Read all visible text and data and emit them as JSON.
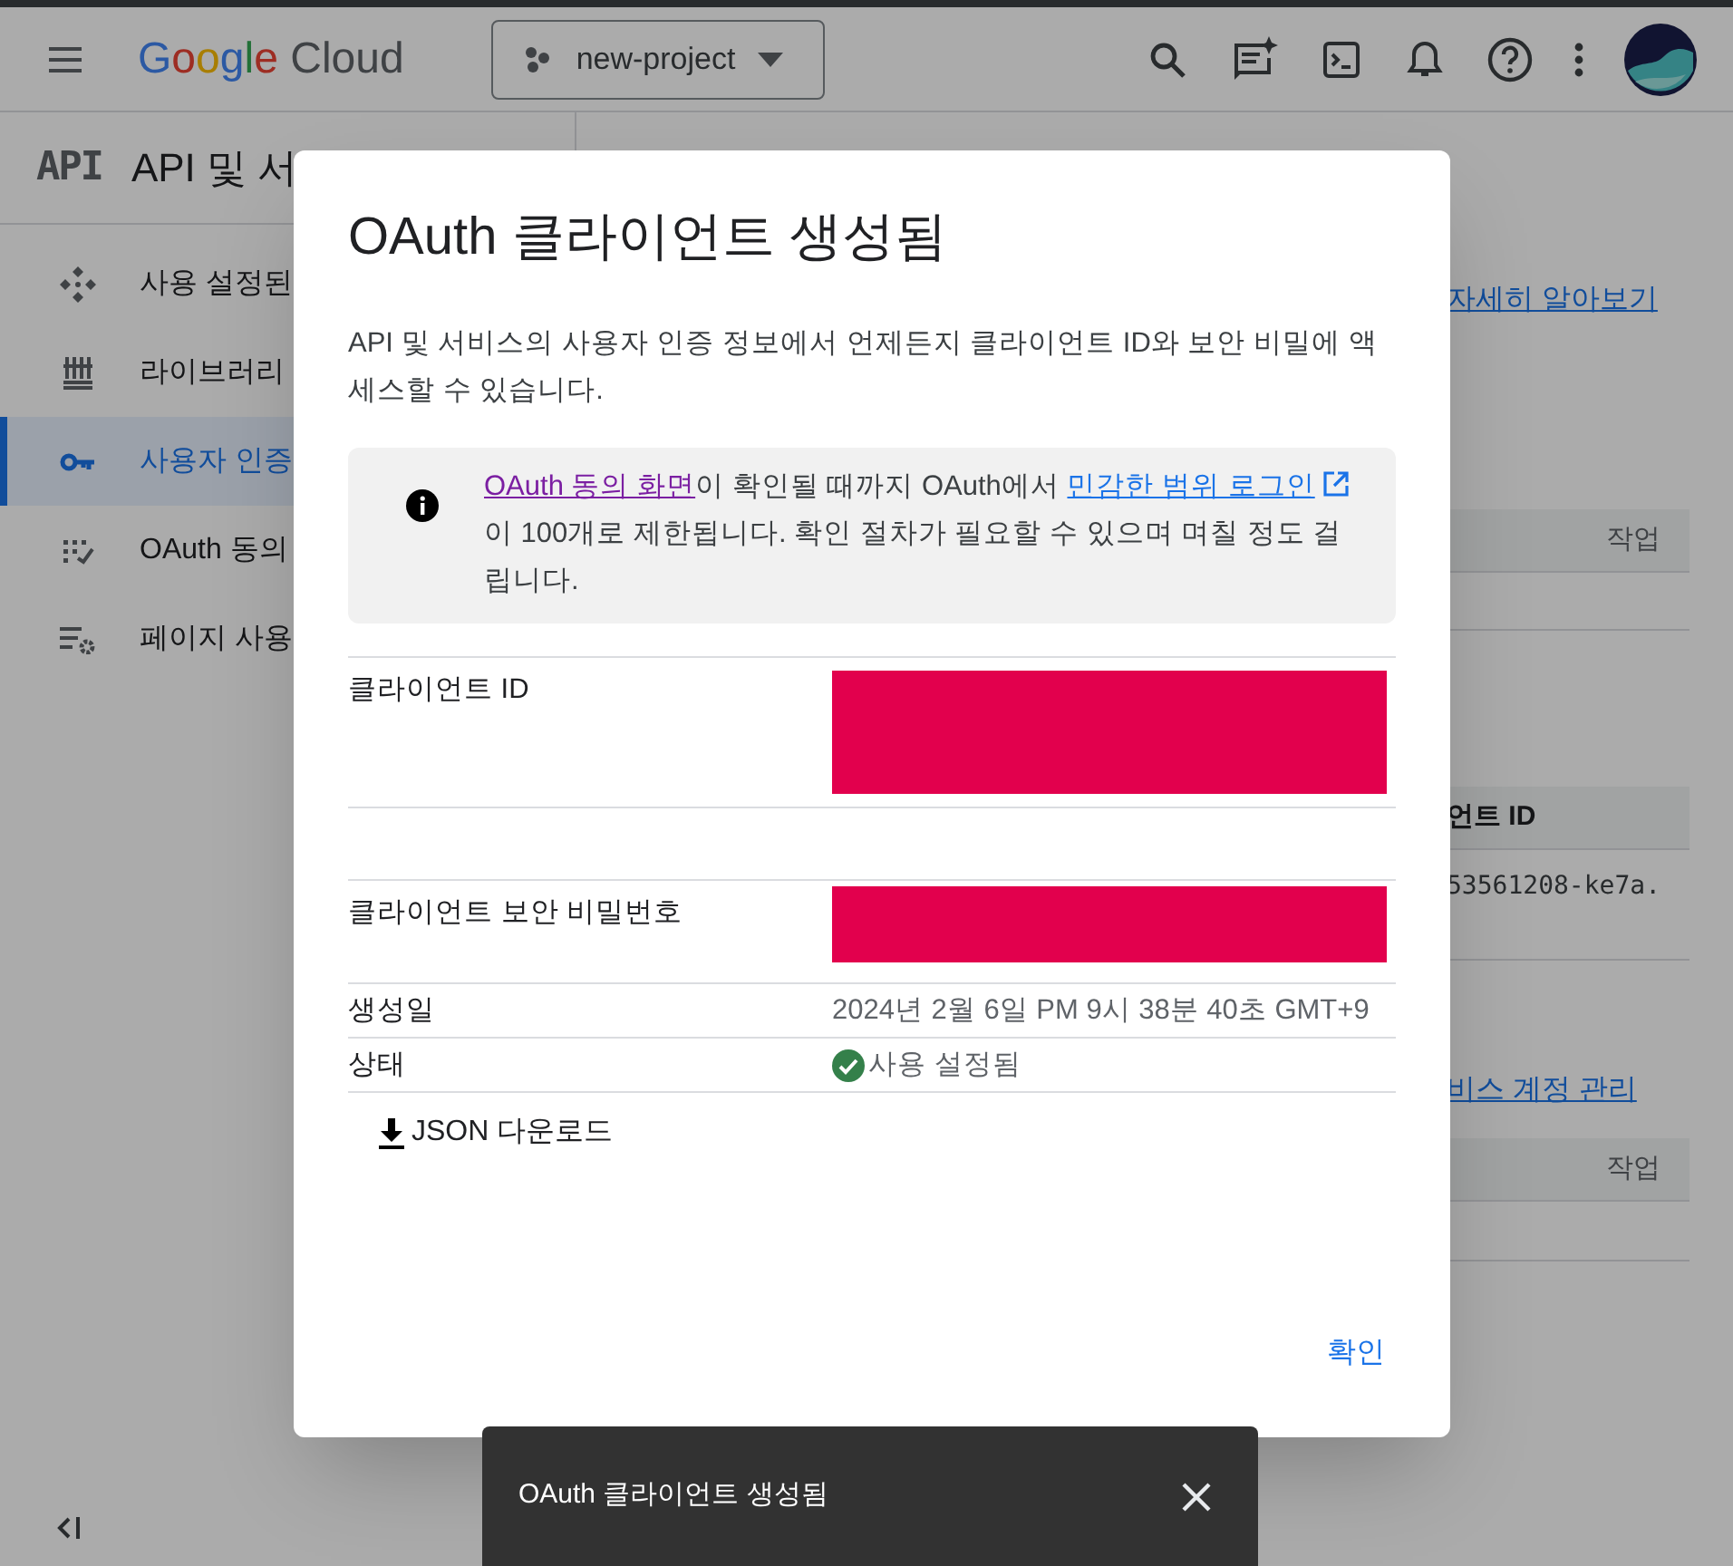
{
  "top_bar": {
    "product": "Google Cloud",
    "project": "new-project"
  },
  "sidebar": {
    "logo": "API",
    "title": "API 및 서",
    "items": [
      {
        "label": "사용 설정된",
        "kind": "enabled",
        "selected": false
      },
      {
        "label": "라이브러리",
        "kind": "library",
        "selected": false
      },
      {
        "label": "사용자 인증",
        "kind": "credentials",
        "selected": true
      },
      {
        "label": "OAuth 동의",
        "kind": "consent",
        "selected": false
      },
      {
        "label": "페이지 사용",
        "kind": "page_usage",
        "selected": false
      }
    ]
  },
  "main": {
    "learn_more_link": "자세히 알아보기",
    "table_1": {
      "column_header": "작업"
    },
    "table_2": {
      "column_header": "언트 ID",
      "cell": "53561208-ke7a."
    },
    "service_accounts_link": "비스 계정 관리",
    "table_3": {
      "column_header": "작업"
    }
  },
  "dialog": {
    "title": "OAuth 클라이언트 생성됨",
    "description": "API 및 서비스의 사용자 인증 정보에서 언제든지 클라이언트 ID와 보안 비밀에 액세스할 수 있습니다.",
    "notice": [
      {
        "kind": "link",
        "text": "OAuth 동의 화면",
        "visited": true
      },
      {
        "kind": "text",
        "text": "이 확인될 때까지 OAuth에서 "
      },
      {
        "kind": "external_link",
        "text": "민감한 범위 로그인",
        "visited": false
      },
      {
        "kind": "text",
        "text": "이 100개로 제한됩니다. 확인 절차가 필요할 수 있으며 며칠 정도 걸립니다."
      }
    ],
    "details": [
      {
        "kind": "secret",
        "label": "클라이언트 ID",
        "redacted": true
      },
      {
        "kind": "secret",
        "label": "클라이언트 보안 비밀번호",
        "redacted": true
      },
      {
        "kind": "text",
        "label": "생성일",
        "value": "2024년 2월 6일 PM 9시 38분 40초 GMT+9"
      },
      {
        "kind": "status",
        "label": "상태",
        "value": "사용 설정됨"
      }
    ],
    "download_button": "JSON 다운로드",
    "confirm_button": "확인"
  },
  "snackbar": {
    "message": "OAuth 클라이언트 생성됨"
  }
}
